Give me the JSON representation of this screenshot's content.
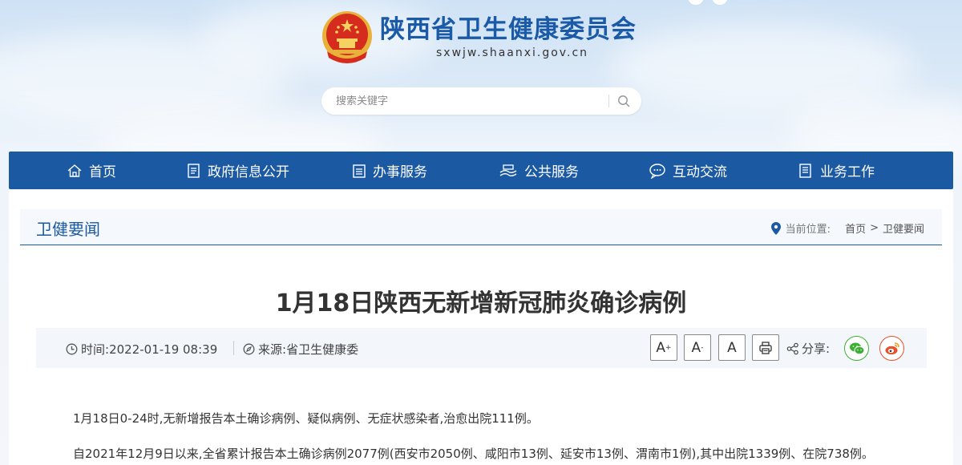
{
  "header": {
    "title": "陕西省卫生健康委员会",
    "url": "sxwjw.shaanxi.gov.cn"
  },
  "search": {
    "placeholder": "搜索关键字"
  },
  "nav": {
    "items": [
      {
        "label": "首页",
        "icon": "home-icon"
      },
      {
        "label": "政府信息公开",
        "icon": "document-icon"
      },
      {
        "label": "办事服务",
        "icon": "clipboard-icon"
      },
      {
        "label": "公共服务",
        "icon": "hands-icon"
      },
      {
        "label": "互动交流",
        "icon": "chat-icon"
      },
      {
        "label": "业务工作",
        "icon": "book-icon"
      }
    ]
  },
  "section": {
    "title": "卫健要闻"
  },
  "breadcrumb": {
    "label": "当前位置:",
    "home": "首页",
    "separator": ">",
    "current": "卫健要闻"
  },
  "article": {
    "title": "1月18日陕西无新增新冠肺炎确诊病例",
    "time_label": "时间:",
    "time": "2022-01-19 08:39",
    "source_label": "来源:",
    "source": "省卫生健康委",
    "font_buttons": {
      "large": "A",
      "medium": "A",
      "default": "A"
    },
    "share_label": "分享:",
    "paragraphs": [
      "1月18日0-24时,无新增报告本土确诊病例、疑似病例、无症状感染者,治愈出院111例。",
      "自2021年12月9日以来,全省累计报告本土确诊病例2077例(西安市2050例、咸阳市13例、延安市13例、渭南市1例),其中出院1339例、在院738例。"
    ]
  },
  "colors": {
    "brand_blue": "#1b5aa2",
    "wechat_green": "#3cb034",
    "weibo_red": "#e6502a"
  }
}
